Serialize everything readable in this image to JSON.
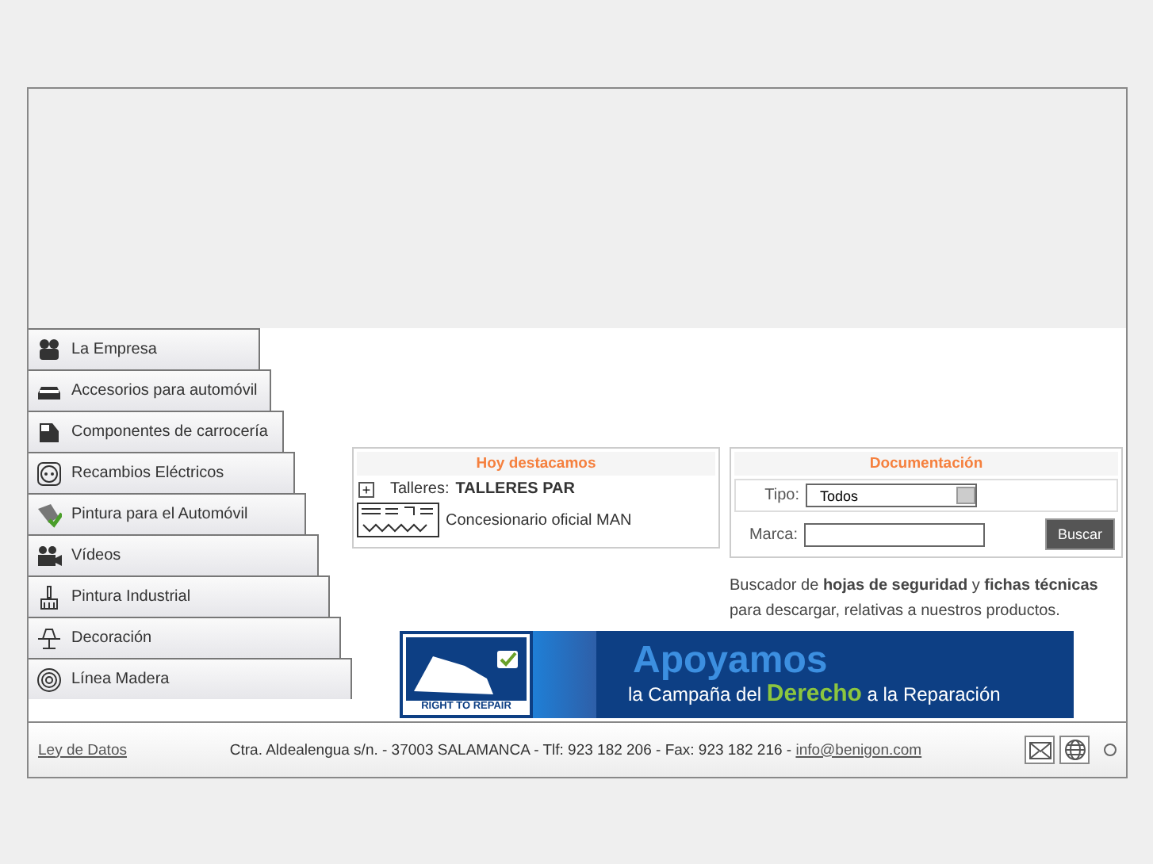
{
  "menu": [
    {
      "label": "La Empresa"
    },
    {
      "label": "Accesorios para automóvil"
    },
    {
      "label": "Componentes de carrocería"
    },
    {
      "label": "Recambios Eléctricos"
    },
    {
      "label": "Pintura para el Automóvil"
    },
    {
      "label": "Vídeos"
    },
    {
      "label": "Pintura Industrial"
    },
    {
      "label": "Decoración"
    },
    {
      "label": "Línea Madera"
    }
  ],
  "featured": {
    "title": "Hoy destacamos",
    "expand": "+",
    "label": "Talleres:",
    "value": "TALLERES PAR",
    "dealer": "Concesionario oficial MAN"
  },
  "docs": {
    "title": "Documentación",
    "type_label": "Tipo:",
    "type_value": "Todos",
    "brand_label": "Marca:",
    "button": "Buscar",
    "description": "Buscador de **hojas de seguridad** y **fichas técnicas** para descargar, relativas a nuestros productos."
  },
  "banner": {
    "logo_text": "RIGHT TO REPAIR",
    "headline": "Apoyamos",
    "tagline": "la Campaña del **Derecho** a la Reparación"
  },
  "footer": {
    "link": "Ley de Datos",
    "address": "Ctra. Aldealengua s/n. - 37003 SALAMANCA - Tlf: 923 182 206 - Fax: 923 182 216 -",
    "email": "info@benigon.com"
  }
}
